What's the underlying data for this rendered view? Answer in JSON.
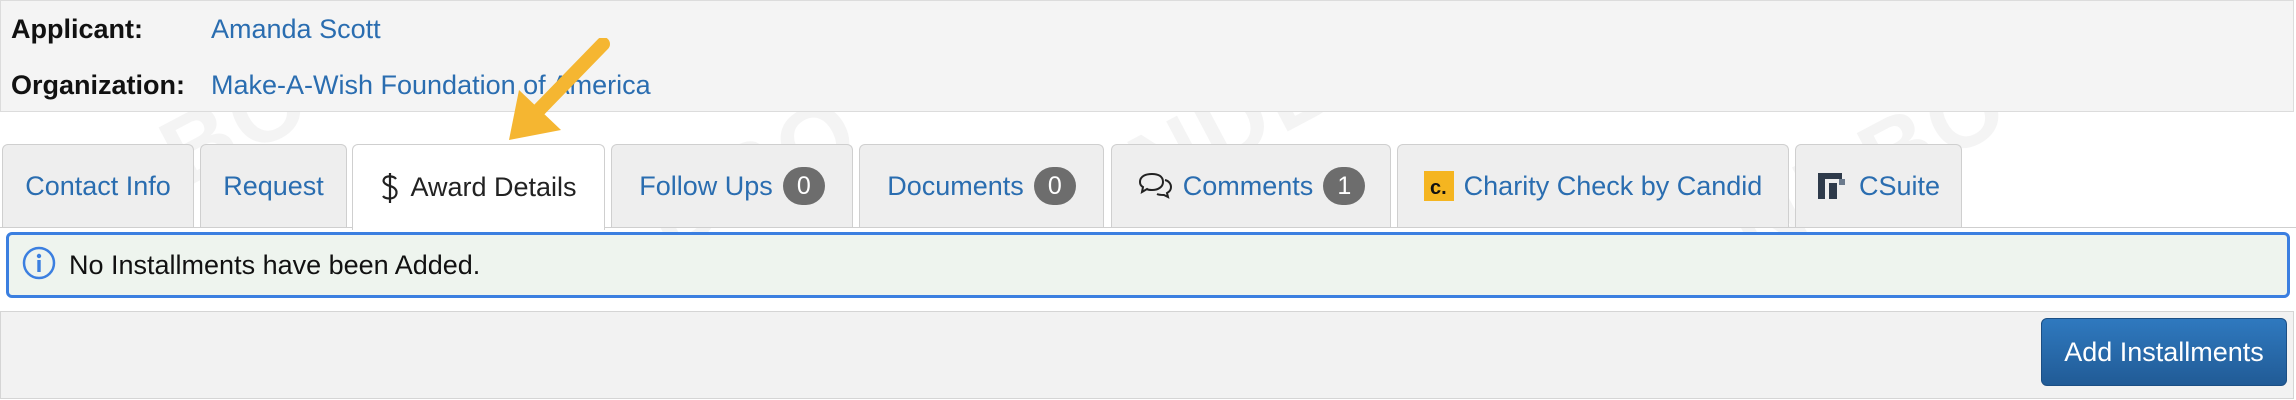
{
  "applicant": {
    "label": "Applicant:",
    "value": "Amanda Scott"
  },
  "organization": {
    "label": "Organization:",
    "value": "Make-A-Wish Foundation of America"
  },
  "tabs": [
    {
      "label": "Contact Info"
    },
    {
      "label": "Request"
    },
    {
      "label": "Award Details",
      "icon": "dollar-icon",
      "active": true
    },
    {
      "label": "Follow Ups",
      "count": "0"
    },
    {
      "label": "Documents",
      "count": "0"
    },
    {
      "label": "Comments",
      "count": "1",
      "icon": "comments-icon"
    },
    {
      "label": "Charity Check by Candid",
      "icon": "candid-logo-icon"
    },
    {
      "label": "CSuite",
      "icon": "csuite-logo-icon"
    }
  ],
  "alert": {
    "icon": "info-icon",
    "text": "No Installments have been Added."
  },
  "actions": {
    "add_installments_label": "Add Installments"
  },
  "watermark": "SANDBOX",
  "colors": {
    "link": "#2a6db0",
    "badge": "#6d6d6d",
    "primary_button": "#2a6aa8",
    "alert_border": "#3b7fe0",
    "arrow": "#f5b631"
  }
}
